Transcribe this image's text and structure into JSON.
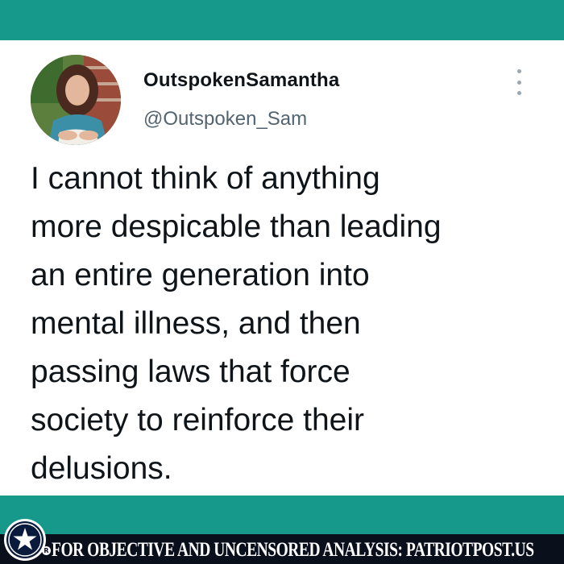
{
  "tweet": {
    "display_name": "OutspokenSamantha",
    "handle": "@Outspoken_Sam",
    "text": "I cannot think of anything\nmore despicable than leading\nan entire generation into\nmental illness, and then\npassing laws that force\nsociety to reinforce their\ndelusions.",
    "avatar_icon": "profile-photo",
    "menu_icon": "more-vertical-icon"
  },
  "footer": {
    "text": "FOR OBJECTIVE AND UNCENSORED ANALYSIS: PATRIOTPOST.US",
    "registered": "R",
    "logo_icon": "star-seal-logo"
  },
  "colors": {
    "teal_band": "#16998a",
    "footer_background": "#0a0f1c",
    "text_primary": "#0f1419",
    "text_secondary": "#536471"
  }
}
